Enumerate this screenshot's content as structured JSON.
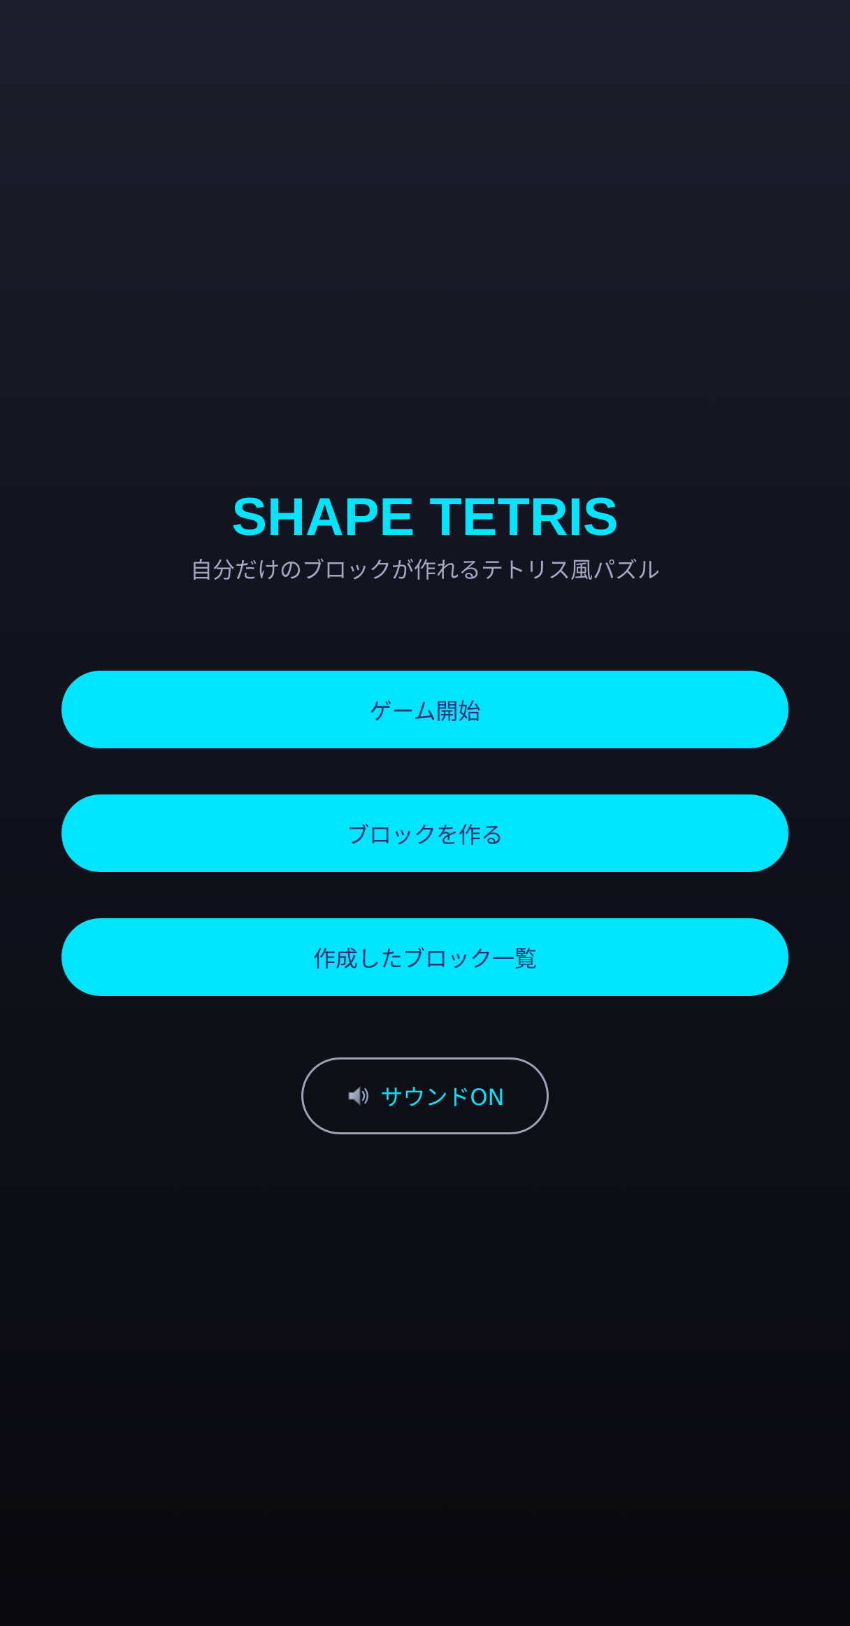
{
  "title": "SHAPE TETRIS",
  "subtitle": "自分だけのブロックが作れるテトリス風パズル",
  "menu": {
    "start_label": "ゲーム開始",
    "create_label": "ブロックを作る",
    "list_label": "作成したブロック一覧"
  },
  "sound": {
    "icon": "speaker-icon",
    "label": "サウンドON"
  },
  "colors": {
    "accent": "#00e5ff",
    "button_text": "#2a3270",
    "subtitle": "#a3a8c3",
    "background_top": "#1d1d2b",
    "background_bottom": "#08080d"
  }
}
